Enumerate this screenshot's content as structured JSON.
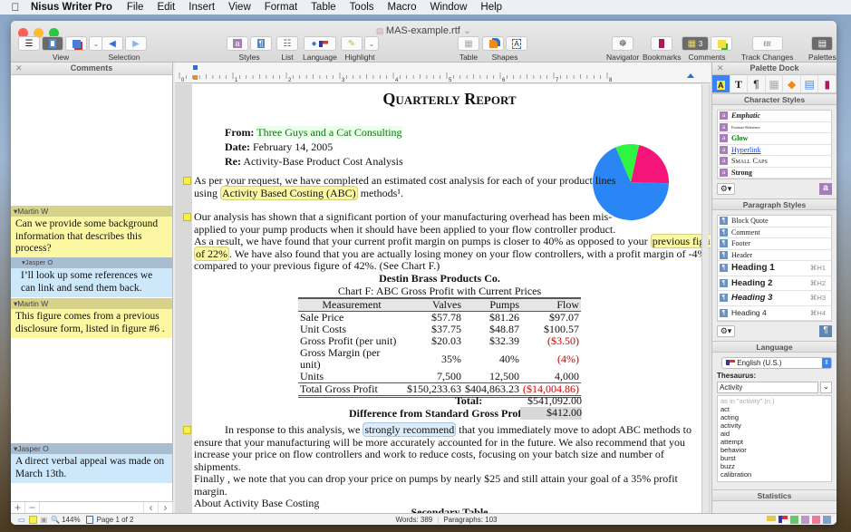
{
  "menubar": {
    "apple": "",
    "app": "Nisus Writer Pro",
    "items": [
      "File",
      "Edit",
      "Insert",
      "View",
      "Format",
      "Table",
      "Tools",
      "Macro",
      "Window",
      "Help"
    ]
  },
  "window": {
    "title": "MAS-example.rtf",
    "title_suffix": "⌄"
  },
  "toolbar": {
    "view": "View",
    "selection": "Selection",
    "styles": "Styles",
    "list": "List",
    "language": "Language",
    "highlight": "Highlight",
    "table": "Table",
    "shapes": "Shapes",
    "navigator": "Navigator",
    "bookmarks": "Bookmarks",
    "comments": "Comments",
    "comments_count": "3",
    "track_changes": "Track Changes",
    "palettes": "Palettes"
  },
  "comments_panel": {
    "title": "Comments",
    "items": [
      {
        "author": "Martin W",
        "text": "Can we provide some background information that describes this process?",
        "color": "yellow"
      },
      {
        "author": "Jasper O",
        "text": "I’ll look up some references we can link and send them back.",
        "color": "blue",
        "reply": true
      },
      {
        "author": "Martin W",
        "text": "This figure comes from a previous disclosure form, listed in figure #6 .",
        "color": "yellow"
      },
      {
        "author": "Jasper O",
        "text": "A direct verbal appeal was made on March 13th.",
        "color": "blue"
      }
    ]
  },
  "ruler": {
    "labels": [
      "0",
      "1",
      "2",
      "3",
      "4",
      "5",
      "6",
      "7",
      "8"
    ]
  },
  "document": {
    "title": "Quarterly Report",
    "from_label": "From:",
    "from": "Three Guys and a Cat Consulting",
    "date_label": "Date:",
    "date": "February 14, 2005",
    "re_label": "Re:",
    "re": "Activity-Base Product Cost Analysis",
    "p1a": "As per your request, we have completed an estimated cost analysis for each of your product lines",
    "p1b_pre": "using ",
    "p1b_hl": "Activity Based Costing (ABC)",
    "p1b_post": " methods¹.",
    "p2a": "Our analysis has shown that a significant portion of your manufacturing overhead has been mis-",
    "p2b": "applied to your pump products when it should have been applied to your flow controller product.",
    "p2c_pre": "As a result, we have found that your current profit margin on pumps is closer to 40% as opposed to your ",
    "p2c_hl": "previous figure",
    "p2d_hl": "of 22%",
    "p2d_post": ". We have also found that you are actually losing money on your flow controllers, with a profit margin of -4%,",
    "p2e": "compared to your previous figure of 42%. (See Chart F.)",
    "p3a_pre": "In response to this analysis, we ",
    "p3a_hl": "strongly recommend",
    "p3a_post": " that you immediately move to adopt ABC methods to",
    "p3b": "ensure that your manufacturing will be more accurately accounted for in the future. We also recommend that you",
    "p3c": "increase your price on flow controllers and work to reduce costs, focusing on your batch size and number of shipments.",
    "p3d": "Finally , we note that you can drop your price on pumps by nearly $25 and still attain your goal of a 35% profit margin.",
    "p3e": "About Activity Base Costing",
    "secondary": "Secondary Table",
    "pie": {
      "slices": [
        {
          "label": "pink",
          "value": 22,
          "color": "#f5157a"
        },
        {
          "label": "blue",
          "value": 68,
          "color": "#2a86f5"
        },
        {
          "label": "green",
          "value": 10,
          "color": "#2ef542"
        }
      ]
    }
  },
  "table": {
    "company": "Destin Brass Products Co.",
    "caption": "Chart F: ABC Gross Profit with Current Prices",
    "headers": [
      "Measurement",
      "Valves",
      "Pumps",
      "Flow"
    ],
    "rows": [
      [
        "Sale Price",
        "$57.78",
        "$81.26",
        "$97.07"
      ],
      [
        "Unit Costs",
        "$37.75",
        "$48.87",
        "$100.57"
      ],
      [
        "Gross Profit (per unit)",
        "$20.03",
        "$32.39",
        "($3.50)"
      ],
      [
        "Gross Margin (per unit)",
        "35%",
        "40%",
        "(4%)"
      ],
      [
        "Units",
        "7,500",
        "12,500",
        "4,000"
      ]
    ],
    "total_row": [
      "Total Gross Profit",
      "$150,233.63",
      "$404,863.23",
      "($14,004.86)"
    ],
    "total_label": "Total:",
    "total_value": "$541,092.00",
    "diff_label": "Difference from Standard Gross Profit:",
    "diff_value": "$412.00"
  },
  "status": {
    "zoom": "144%",
    "page": "Page 1 of 2",
    "words": "Words: 389",
    "paragraphs": "Paragraphs: 103"
  },
  "palette": {
    "title": "Palette Dock",
    "char_styles_title": "Character Styles",
    "char_styles": [
      "Emphatic",
      "Footnote Reference",
      "Glow",
      "Hyperlink",
      "Small Caps",
      "Strong"
    ],
    "para_styles_title": "Paragraph Styles",
    "para_styles": [
      {
        "name": "Block Quote",
        "shortcut": ""
      },
      {
        "name": "Comment",
        "shortcut": ""
      },
      {
        "name": "Footer",
        "shortcut": ""
      },
      {
        "name": "Header",
        "shortcut": ""
      },
      {
        "name": "Heading 1",
        "shortcut": "⌘H1"
      },
      {
        "name": "Heading 2",
        "shortcut": "⌘H2"
      },
      {
        "name": "Heading 3",
        "shortcut": "⌘H3"
      },
      {
        "name": "Heading 4",
        "shortcut": "⌘H4"
      }
    ],
    "language_title": "Language",
    "language": "English (U.S.)",
    "thesaurus_label": "Thesaurus:",
    "thesaurus_value": "Activity",
    "thesaurus_header": "as in \"activity\" (n.)",
    "thesaurus_words": [
      "act",
      "acting",
      "activity",
      "aid",
      "attempt",
      "behavior",
      "burst",
      "buzz",
      "calibration"
    ],
    "statistics_title": "Statistics"
  }
}
